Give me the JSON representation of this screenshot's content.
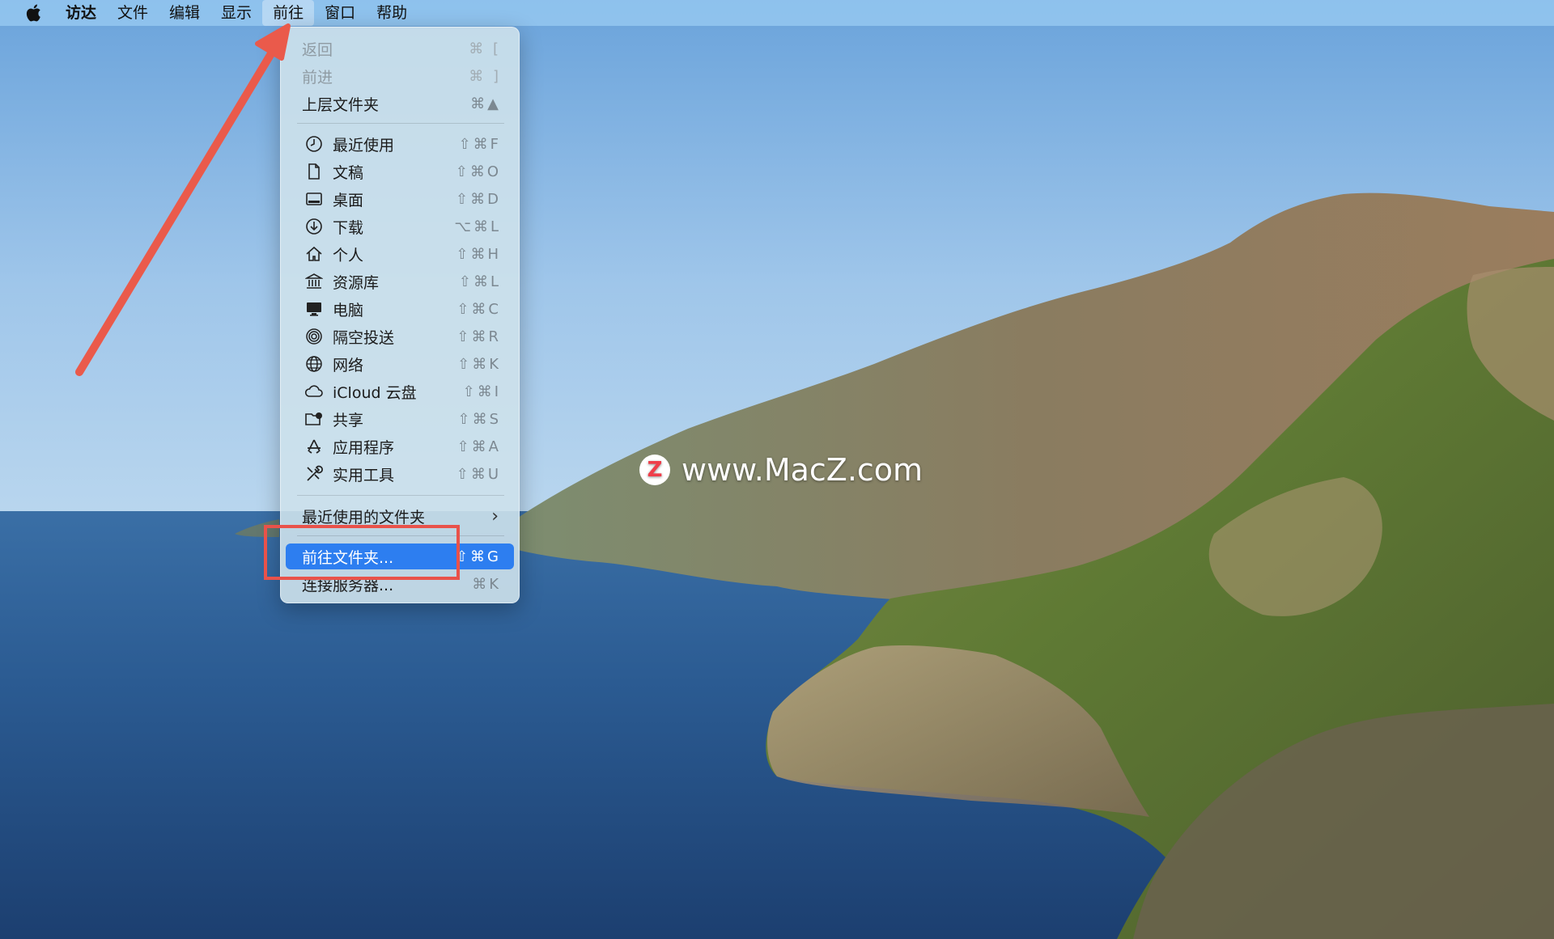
{
  "menubar": {
    "apple_icon": "apple-logo-icon",
    "items": [
      "访达",
      "文件",
      "编辑",
      "显示",
      "前往",
      "窗口",
      "帮助"
    ],
    "active_item": "前往"
  },
  "go_menu": {
    "back": {
      "label": "返回",
      "shortcut": "⌘ ["
    },
    "forward": {
      "label": "前进",
      "shortcut": "⌘ ]"
    },
    "enclosing": {
      "label": "上层文件夹",
      "shortcut": "⌘▲"
    },
    "recents": {
      "label": "最近使用",
      "shortcut": "⇧⌘F",
      "icon": "clock-icon"
    },
    "documents": {
      "label": "文稿",
      "shortcut": "⇧⌘O",
      "icon": "document-icon"
    },
    "desktop": {
      "label": "桌面",
      "shortcut": "⇧⌘D",
      "icon": "desktop-icon"
    },
    "downloads": {
      "label": "下载",
      "shortcut": "⌥⌘L",
      "icon": "download-icon"
    },
    "home": {
      "label": "个人",
      "shortcut": "⇧⌘H",
      "icon": "house-icon"
    },
    "library": {
      "label": "资源库",
      "shortcut": "⇧⌘L",
      "icon": "library-icon"
    },
    "computer": {
      "label": "电脑",
      "shortcut": "⇧⌘C",
      "icon": "computer-icon"
    },
    "airdrop": {
      "label": "隔空投送",
      "shortcut": "⇧⌘R",
      "icon": "airdrop-icon"
    },
    "network": {
      "label": "网络",
      "shortcut": "⇧⌘K",
      "icon": "globe-icon"
    },
    "icloud": {
      "label": "iCloud 云盘",
      "shortcut": "⇧⌘I",
      "icon": "cloud-icon"
    },
    "shared": {
      "label": "共享",
      "shortcut": "⇧⌘S",
      "icon": "shared-folder-icon"
    },
    "applications": {
      "label": "应用程序",
      "shortcut": "⇧⌘A",
      "icon": "app-store-icon"
    },
    "utilities": {
      "label": "实用工具",
      "shortcut": "⇧⌘U",
      "icon": "tools-icon"
    },
    "recent_folders": {
      "label": "最近使用的文件夹",
      "chevron": "›"
    },
    "go_to_folder": {
      "label": "前往文件夹...",
      "shortcut": "⇧⌘G"
    },
    "connect_server": {
      "label": "连接服务器...",
      "shortcut": "⌘K"
    }
  },
  "watermark": {
    "logo_letter": "Z",
    "text": "www.MacZ.com"
  },
  "colors": {
    "sky_top": "#6fa6dc",
    "sea": "#2e5f95",
    "menu_highlight": "#2d7ef0",
    "annotation_red": "#e9524a"
  }
}
